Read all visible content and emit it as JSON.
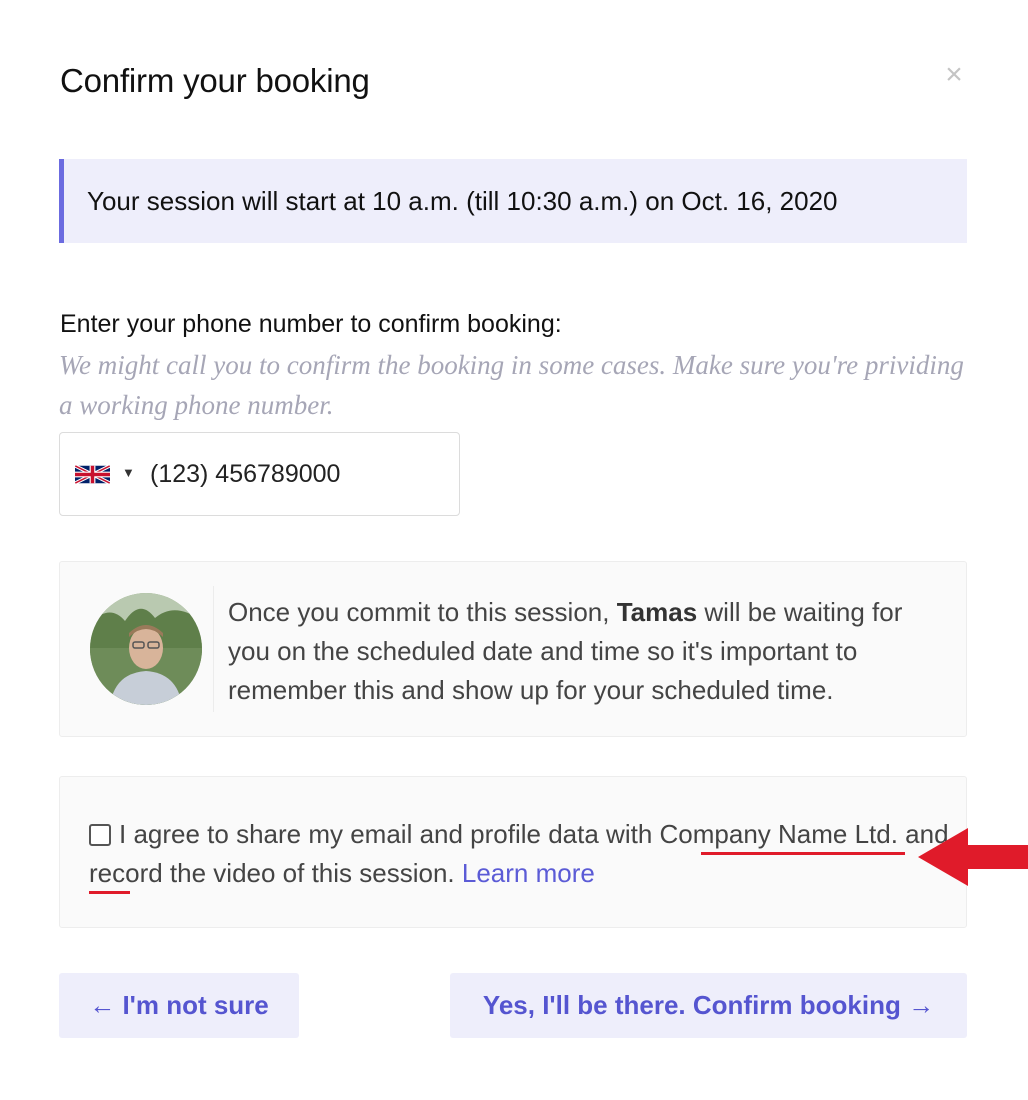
{
  "dialog": {
    "title": "Confirm your booking",
    "close_label": "×"
  },
  "session_notice": "Your session will start at 10 a.m. (till 10:30 a.m.) on Oct. 16, 2020",
  "phone": {
    "label": "Enter your phone number to confirm booking:",
    "help": "We might call you to confirm the booking in some cases. Make sure you're prividing a working phone number.",
    "country_flag": "uk-flag-icon",
    "value": "(123) 456789000"
  },
  "host_card": {
    "text_before": "Once you commit to this session, ",
    "host_name": "Tamas",
    "text_after": " will be waiting for you on the scheduled date and time so it's important to remember this and show up for your scheduled time."
  },
  "consent": {
    "checked": false,
    "text": "I agree to share my email and profile data with Company Name Ltd. and record the video of this session.",
    "learn_more": "Learn more"
  },
  "buttons": {
    "back": "← I'm not sure",
    "confirm": "Yes, I'll be there. Confirm booking →"
  },
  "colors": {
    "accent": "#5b5bd6",
    "notice_bg": "#eeeefb",
    "annotation": "#e01b2a"
  }
}
